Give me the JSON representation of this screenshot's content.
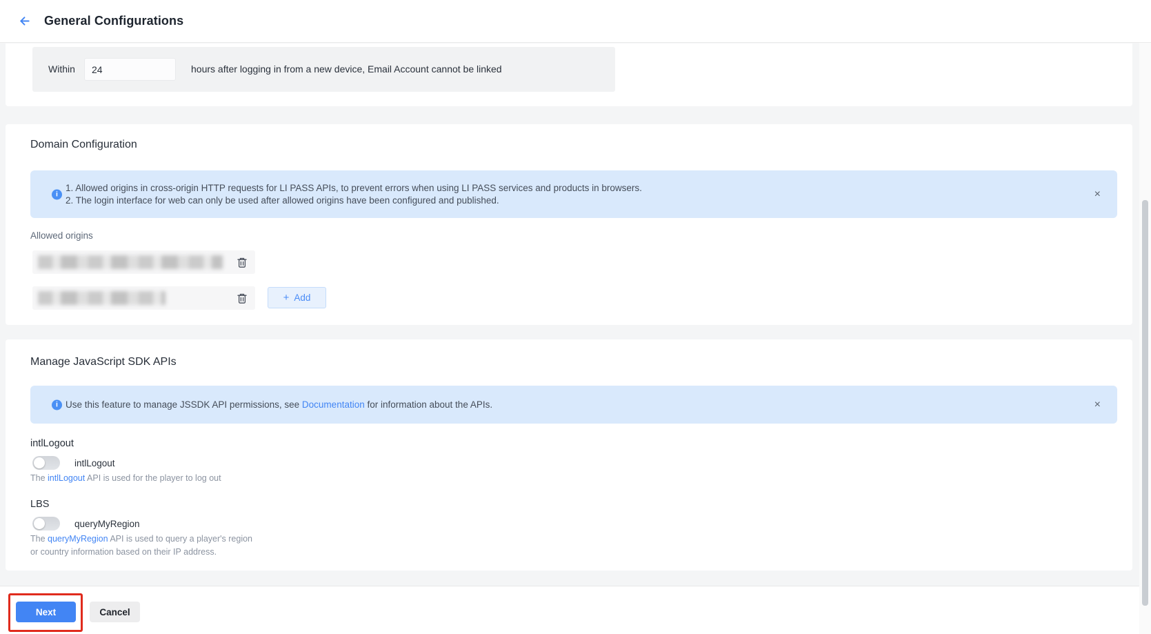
{
  "header": {
    "title": "General Configurations"
  },
  "colors": {
    "accent": "#4285f4",
    "banner_bg": "#d9e9fc",
    "annotation_red": "#e02b1d",
    "toggle_off": "#d8dbdf"
  },
  "device_rule": {
    "label": "Within",
    "hours_value": "24",
    "suffix": "hours after logging in from a new device, Email Account cannot be linked"
  },
  "domain_config": {
    "title": "Domain Configuration",
    "banner": {
      "line1": "1. Allowed origins in cross-origin HTTP requests for LI PASS APIs, to prevent errors when using LI PASS services and products in browsers.",
      "line2": "2. The login interface for web can only be used after allowed origins have been configured and published.",
      "close_symbol": "×"
    },
    "allowed_origins_label": "Allowed origins",
    "origins": [
      {
        "redacted": true
      },
      {
        "redacted": true
      }
    ],
    "add_button": {
      "plus": "+",
      "label": "Add"
    }
  },
  "jssdk": {
    "title": "Manage JavaScript SDK APIs",
    "banner": {
      "text_before_link": "Use this feature to manage JSSDK API permissions, see ",
      "link": "Documentation",
      "text_after_link": " for information about the APIs.",
      "close_symbol": "×"
    },
    "groups": [
      {
        "heading": "intlLogout",
        "toggle_label": "intlLogout",
        "toggle_state": "off",
        "desc_before_link": "The ",
        "desc_link": "intlLogout",
        "desc_after_link": " API is used for the player to log out"
      },
      {
        "heading": "LBS",
        "toggle_label": "queryMyRegion",
        "toggle_state": "off",
        "desc_before_link": "The ",
        "desc_link": "queryMyRegion",
        "desc_after_link": " API is used to query a player's region or country information based on their IP address."
      }
    ]
  },
  "footer": {
    "next_label": "Next",
    "cancel_label": "Cancel"
  }
}
